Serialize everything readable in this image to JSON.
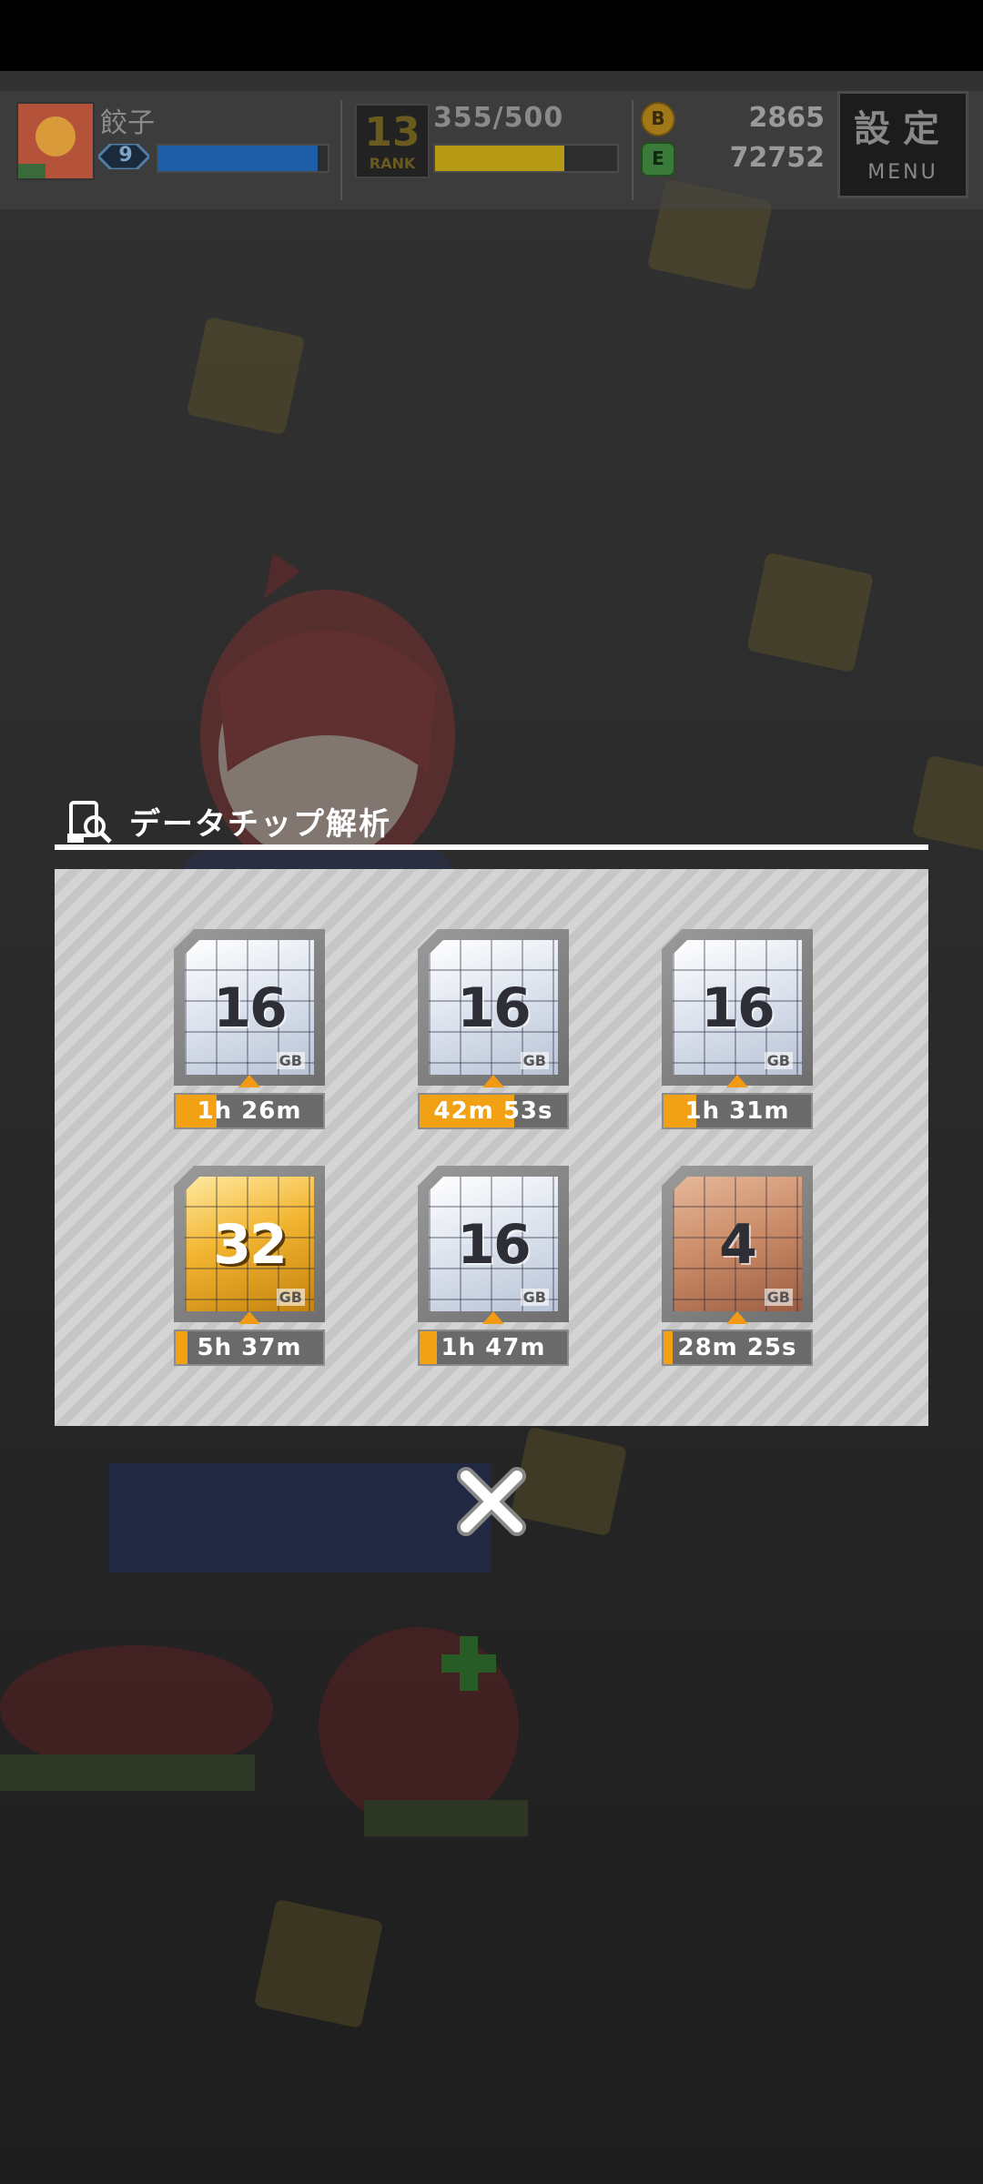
{
  "hud": {
    "player_name": "餃子",
    "player_level": "9",
    "player_xp_fill": 0.94,
    "rank_number": "13",
    "rank_label": "RANK",
    "rank_progress_text": "355/500",
    "rank_progress_fill": 0.71,
    "coins": "2865",
    "energy": "72752",
    "coin_icon_letter": "B",
    "energy_icon_letter": "E",
    "menu_kanji": "設定",
    "menu_label": "MENU"
  },
  "modal": {
    "title": "データチップ解析",
    "chips": [
      {
        "size": "16",
        "unit": "GB",
        "tier": "silver",
        "timer": "1h 26m",
        "progress": 0.28
      },
      {
        "size": "16",
        "unit": "GB",
        "tier": "silver",
        "timer": "42m 53s",
        "progress": 0.64
      },
      {
        "size": "16",
        "unit": "GB",
        "tier": "silver",
        "timer": "1h 31m",
        "progress": 0.22
      },
      {
        "size": "32",
        "unit": "GB",
        "tier": "gold",
        "timer": "5h 37m",
        "progress": 0.08
      },
      {
        "size": "16",
        "unit": "GB",
        "tier": "silver",
        "timer": "1h 47m",
        "progress": 0.12
      },
      {
        "size": "4",
        "unit": "GB",
        "tier": "bronze",
        "timer": "28m 25s",
        "progress": 0.06
      }
    ],
    "close_icon": "close-icon"
  },
  "colors": {
    "accent": "#f2a014",
    "xp_bar": "#1d5ea6",
    "rank_bar": "#b69a16"
  }
}
